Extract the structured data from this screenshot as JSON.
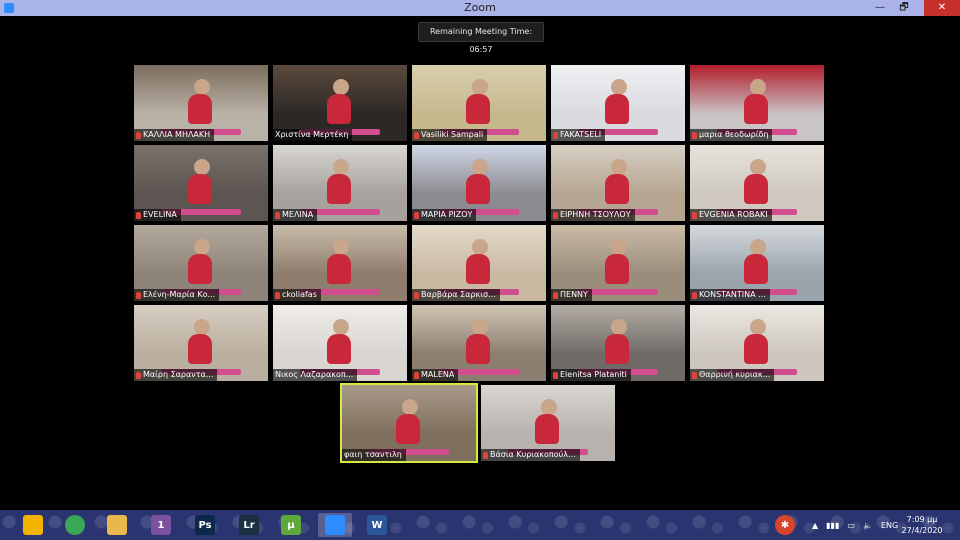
{
  "window": {
    "title": "Zoom",
    "controls": {
      "minimize": "—",
      "maximize": "🗗",
      "close": "✕"
    }
  },
  "meeting": {
    "remaining_time": "Remaining Meeting Time: 06:57"
  },
  "participants": [
    {
      "name": "ΚΑΛΛΙΑ ΜΗΛΑΚΗ",
      "muted": true,
      "scene": "#b9b2a6",
      "top": "#7b6d5e"
    },
    {
      "name": "Χριστίνα Μερτέκη",
      "muted": false,
      "scene": "#2c2826",
      "top": "#5c4a3c"
    },
    {
      "name": "Vasiliki Sampali",
      "muted": true,
      "scene": "#c7b88c",
      "top": "#d8cfae"
    },
    {
      "name": "FAKATSELI",
      "muted": true,
      "scene": "#d9dbe0",
      "top": "#eef0f2"
    },
    {
      "name": "μαρια θεοδωρίδη",
      "muted": true,
      "scene": "#c9c4c6",
      "top": "#b21d2c"
    },
    {
      "name": "EVELINA",
      "muted": true,
      "scene": "#5d5551",
      "top": "#7a716a"
    },
    {
      "name": "ΜΕΛΙΝΑ",
      "muted": true,
      "scene": "#a6a19c",
      "top": "#d8d6d2"
    },
    {
      "name": "ΜΑΡΙΑ ΡΙΖΟΥ",
      "muted": true,
      "scene": "#8b8a90",
      "top": "#cfd6e6"
    },
    {
      "name": "ΕΙΡΗΝΗ ΤΣΟΥΛΟΥ",
      "muted": true,
      "scene": "#b6a590",
      "top": "#d6cfc4"
    },
    {
      "name": "EVGENIA ROBAKI",
      "muted": true,
      "scene": "#cfc9c0",
      "top": "#e7e3dc"
    },
    {
      "name": "Ελένη-Μαρία Κο...",
      "muted": true,
      "scene": "#8d8378",
      "top": "#b2a89b"
    },
    {
      "name": "ckoliafas",
      "muted": true,
      "scene": "#8e7c6c",
      "top": "#c8bcaa"
    },
    {
      "name": "Βαρβάρα Σαρκισ...",
      "muted": true,
      "scene": "#c9b9a3",
      "top": "#e3d9c9"
    },
    {
      "name": "ΠΕΝΝΥ",
      "muted": true,
      "scene": "#9b8d7c",
      "top": "#c9bba6"
    },
    {
      "name": "KONSTANTINA ...",
      "muted": true,
      "scene": "#9aa4ad",
      "top": "#d5d9dc"
    },
    {
      "name": "Μαίρη Σαραντα...",
      "muted": true,
      "scene": "#b9ae9f",
      "top": "#d7cec2"
    },
    {
      "name": "Νικος Λαζαρακοπ...",
      "muted": false,
      "scene": "#d9d6d2",
      "top": "#efece8"
    },
    {
      "name": "MALENA",
      "muted": true,
      "scene": "#8c7f72",
      "top": "#cfc3b3"
    },
    {
      "name": "Elenitsa Plataniti",
      "muted": true,
      "scene": "#6f6a66",
      "top": "#b4ada6"
    },
    {
      "name": "Θαρρινή κυριακ...",
      "muted": true,
      "scene": "#cdc7bf",
      "top": "#ebe7e1"
    },
    {
      "name": "φαιη τσαντιλη",
      "muted": false,
      "scene": "#7e6f5c",
      "top": "#a8998a",
      "active": true
    },
    {
      "name": "Βάσια Κυριακοπούλ...",
      "muted": true,
      "scene": "#b7b2ad",
      "top": "#d9d5d0"
    }
  ],
  "taskbar": {
    "apps": [
      {
        "name": "lightbulb-app",
        "label": "",
        "color": "#f2b400"
      },
      {
        "name": "chrome",
        "label": "",
        "color": "#3aa757"
      },
      {
        "name": "file-explorer",
        "label": "",
        "color": "#e8b84a"
      },
      {
        "name": "viber",
        "label": "1",
        "color": "#7b519d"
      },
      {
        "name": "photoshop",
        "label": "Ps",
        "color": "#0b2a4a"
      },
      {
        "name": "lightroom",
        "label": "Lr",
        "color": "#1a2f3f"
      },
      {
        "name": "utorrent",
        "label": "µ",
        "color": "#5fa83b"
      },
      {
        "name": "zoom",
        "label": "",
        "color": "#2d8cff"
      },
      {
        "name": "word",
        "label": "W",
        "color": "#2b579a"
      }
    ],
    "tray": {
      "language": "ENG",
      "time": "7:09 μμ",
      "date": "27/4/2020"
    }
  }
}
